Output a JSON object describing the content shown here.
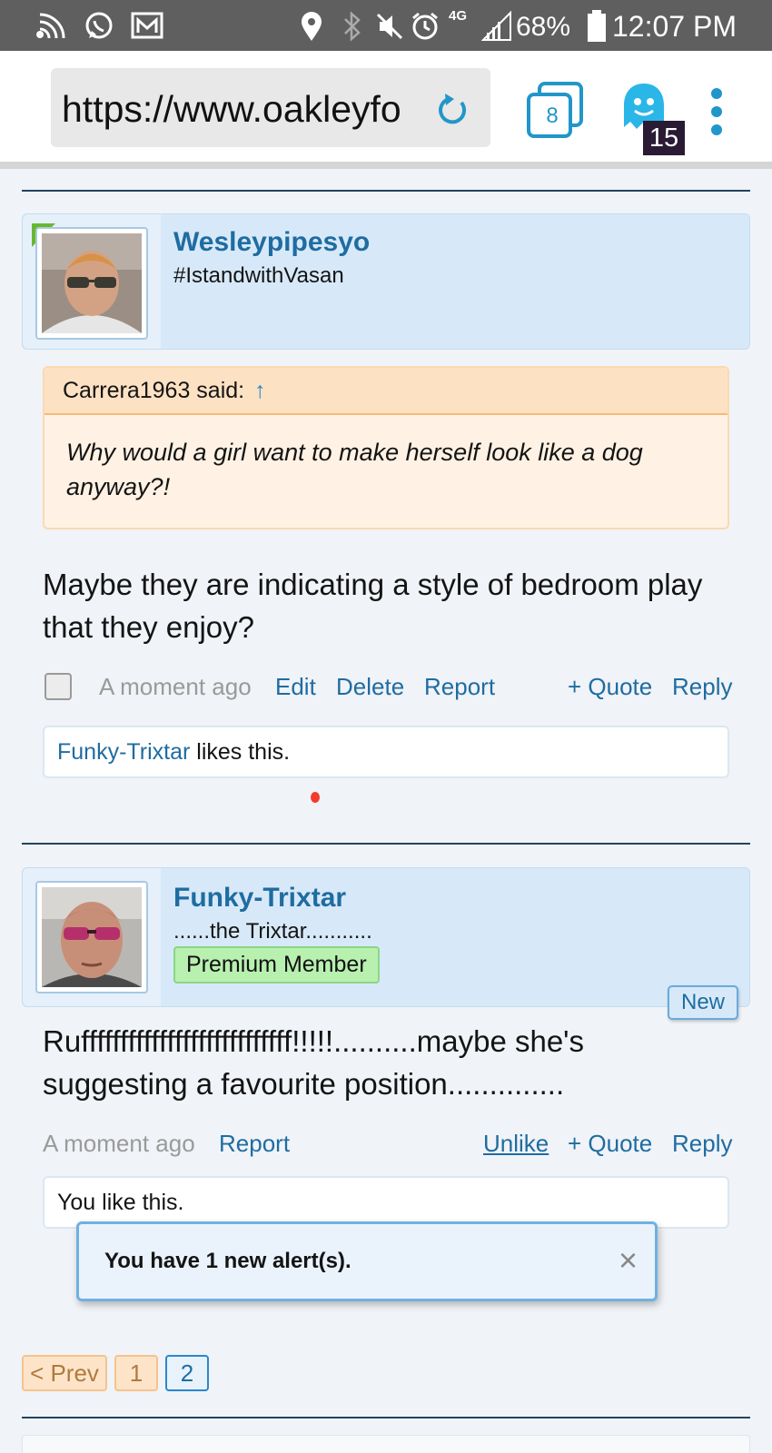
{
  "status_bar": {
    "battery": "68%",
    "time": "12:07 PM",
    "network": "4G"
  },
  "browser": {
    "url": "https://www.oakleyfo",
    "tab_count": "8",
    "ghost_count": "15"
  },
  "posts": [
    {
      "username": "Wesleypipesyo",
      "user_title": "#IstandwithVasan",
      "quote": {
        "author_line": "Carrera1963 said:",
        "arrow": "↑",
        "text": "Why would a girl want to make herself look like a dog anyway?!"
      },
      "message": "Maybe they are indicating a style of bedroom play that they enjoy?",
      "time": "A moment ago",
      "actions": {
        "edit": "Edit",
        "delete": "Delete",
        "report": "Report",
        "quote": "+ Quote",
        "reply": "Reply"
      },
      "likes": {
        "user": "Funky-Trixtar",
        "suffix": " likes this."
      }
    },
    {
      "username": "Funky-Trixtar",
      "user_title": "......the Trixtar...........",
      "badge": "Premium Member",
      "new_label": "New",
      "message": "Rufffffffffffffffffffffffffff!!!!!..........maybe she's suggesting a favourite position..............",
      "time": "A moment ago",
      "actions": {
        "report": "Report",
        "unlike": "Unlike",
        "quote": "+ Quote",
        "reply": "Reply"
      },
      "likes": {
        "text": "You like this."
      }
    }
  ],
  "alert": {
    "text": "You have 1 new alert(s).",
    "close": "×"
  },
  "pagination": {
    "prev": "< Prev",
    "pages": [
      "1",
      "2"
    ],
    "current": "2"
  },
  "colors": {
    "link": "#1f6ca1",
    "accent": "#2196c9",
    "user_bar": "#d7e9f8",
    "quote_bg": "#fff2e4",
    "premium": "#b8f0b0"
  }
}
